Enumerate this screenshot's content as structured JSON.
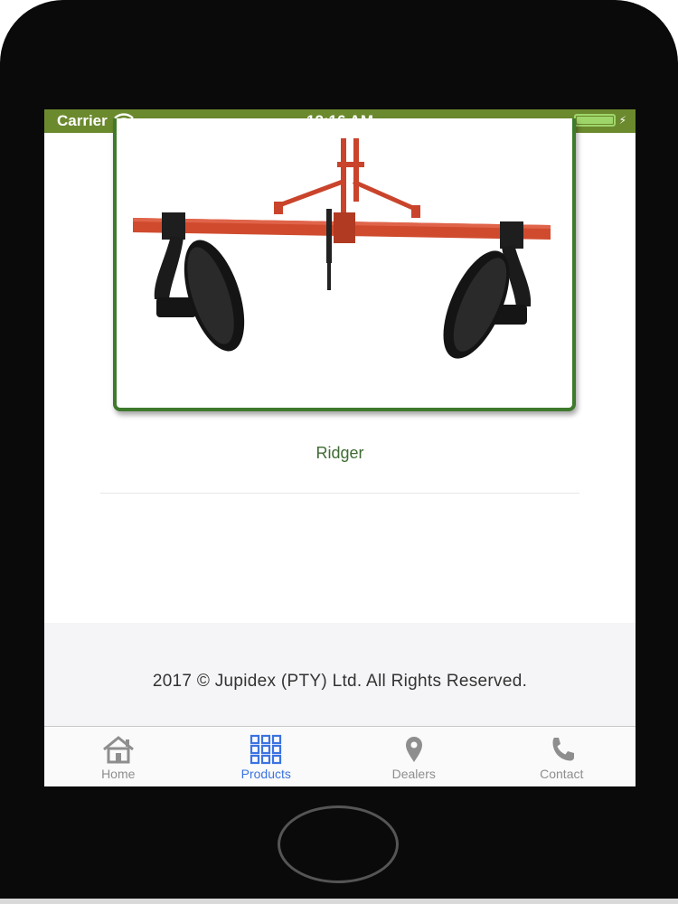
{
  "status_bar": {
    "carrier": "Carrier",
    "time": "12:16 AM",
    "wifi_icon": "wifi-icon",
    "battery_icon": "battery-icon"
  },
  "product": {
    "title": "Ridger",
    "image_icon": "ridger-implement-image"
  },
  "footer": {
    "copyright": "2017 © Jupidex (PTY) Ltd. All Rights Reserved."
  },
  "tabs": [
    {
      "label": "Home",
      "icon": "home-icon",
      "active": false
    },
    {
      "label": "Products",
      "icon": "grid-icon",
      "active": true
    },
    {
      "label": "Dealers",
      "icon": "map-pin-icon",
      "active": false
    },
    {
      "label": "Contact",
      "icon": "phone-icon",
      "active": false
    }
  ],
  "colors": {
    "status_bar": "#6b8a2e",
    "accent": "#3b73e0",
    "title": "#3e6b34",
    "card_border": "#3e7a2c",
    "tab_inactive": "#8e8e8e"
  }
}
